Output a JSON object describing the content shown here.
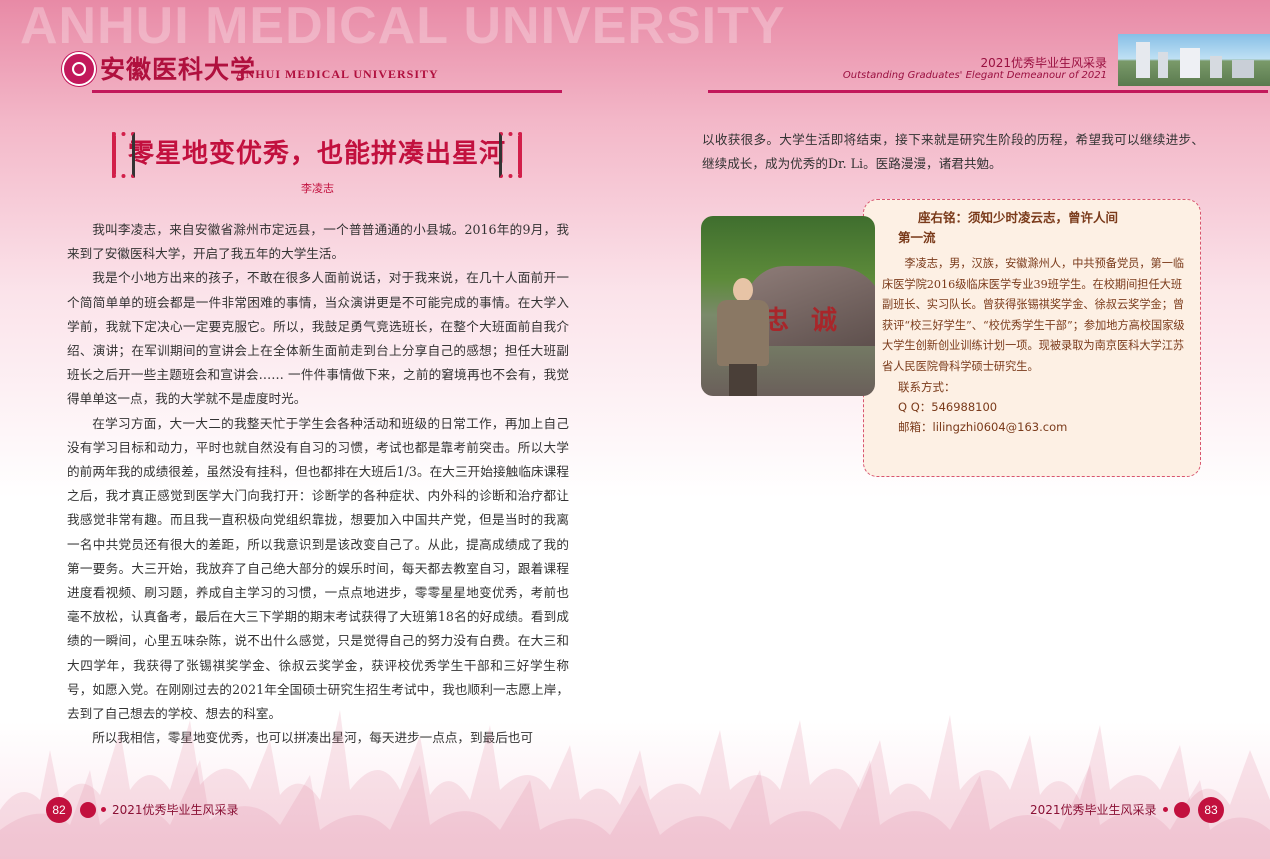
{
  "header": {
    "watermark": "ANHUI MEDICAL UNIVERSITY",
    "logo_cn": "安徽医科大学",
    "logo_en": "ANHUI MEDICAL UNIVERSITY",
    "series_title": "2021优秀毕业生风采录",
    "series_subtitle": "Outstanding Graduates' Elegant Demeanour of 2021"
  },
  "article": {
    "title": "零星地变优秀，也能拼凑出星河",
    "author": "李凌志",
    "paragraphs": [
      "我叫李凌志，来自安徽省滁州市定远县，一个普普通通的小县城。2016年的9月，我来到了安徽医科大学，开启了我五年的大学生活。",
      "我是个小地方出来的孩子，不敢在很多人面前说话，对于我来说，在几十人面前开一个简简单单的班会都是一件非常困难的事情，当众演讲更是不可能完成的事情。在大学入学前，我就下定决心一定要克服它。所以，我鼓足勇气竞选班长，在整个大班面前自我介绍、演讲；在军训期间的宣讲会上在全体新生面前走到台上分享自己的感想；担任大班副班长之后开一些主题班会和宣讲会…… 一件件事情做下来，之前的窘境再也不会有，我觉得单单这一点，我的大学就不是虚度时光。",
      "在学习方面，大一大二的我整天忙于学生会各种活动和班级的日常工作，再加上自己没有学习目标和动力，平时也就自然没有自习的习惯，考试也都是靠考前突击。所以大学的前两年我的成绩很差，虽然没有挂科，但也都排在大班后1/3。在大三开始接触临床课程之后，我才真正感觉到医学大门向我打开：诊断学的各种症状、内外科的诊断和治疗都让我感觉非常有趣。而且我一直积极向党组织靠拢，想要加入中国共产党，但是当时的我离一名中共党员还有很大的差距，所以我意识到是该改变自己了。从此，提高成绩成了我的第一要务。大三开始，我放弃了自己绝大部分的娱乐时间，每天都去教室自习，跟着课程进度看视频、刷习题，养成自主学习的习惯，一点点地进步，零零星星地变优秀，考前也毫不放松，认真备考，最后在大三下学期的期末考试获得了大班第18名的好成绩。看到成绩的一瞬间，心里五味杂陈，说不出什么感觉，只是觉得自己的努力没有白费。在大三和大四学年，我获得了张锡祺奖学金、徐叔云奖学金，获评校优秀学生干部和三好学生称号，如愿入党。在刚刚过去的2021年全国硕士研究生招生考试中，我也顺利一志愿上岸，去到了自己想去的学校、想去的科室。",
      "所以我相信，零星地变优秀，也可以拼凑出星河，每天进步一点点，到最后也可"
    ],
    "continuation": "以收获很多。大学生活即将结束，接下来就是研究生阶段的历程，希望我可以继续进步、继续成长，成为优秀的Dr. Li。医路漫漫，诸君共勉。"
  },
  "photo": {
    "sign_text": "忠诚"
  },
  "profile": {
    "motto_line1": "座右铭：须知少时凌云志，曾许人间",
    "motto_line2": "第一流",
    "bio": "李凌志，男，汉族，安徽滁州人，中共预备党员，第一临床医学院2016级临床医学专业39班学生。在校期间担任大班副班长、实习队长。曾获得张锡祺奖学金、徐叔云奖学金；曾获评“校三好学生”、“校优秀学生干部”；参加地方高校国家级大学生创新创业训练计划一项。现被录取为南京医科大学江苏省人民医院骨科学硕士研究生。",
    "contact_label": "联系方式：",
    "qq": "Q Q：546988100",
    "email": "邮箱：lilingzhi0604@163.com"
  },
  "footer": {
    "left_page": "82",
    "right_page": "83",
    "left_text": "2021优秀毕业生风采录",
    "right_text": "2021优秀毕业生风采录"
  },
  "colors": {
    "accent": "#c2103e",
    "header_pink": "#e88aa6",
    "box_bg": "#fdf0e4"
  }
}
